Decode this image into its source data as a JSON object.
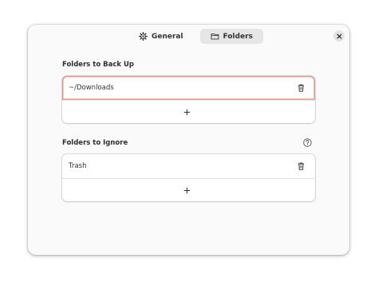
{
  "tabs": [
    {
      "label": "General",
      "icon": "gear-icon",
      "active": false
    },
    {
      "label": "Folders",
      "icon": "folder-icon",
      "active": true
    }
  ],
  "sections": {
    "backup": {
      "title": "Folders to Back Up",
      "items": [
        {
          "path": "~/Downloads"
        }
      ]
    },
    "ignore": {
      "title": "Folders to Ignore",
      "items": [
        {
          "path": "Trash"
        }
      ]
    }
  },
  "colors": {
    "accent": "#e59a83",
    "dialog_bg": "#fafafa",
    "tab_active_bg": "#e6e6e6"
  }
}
